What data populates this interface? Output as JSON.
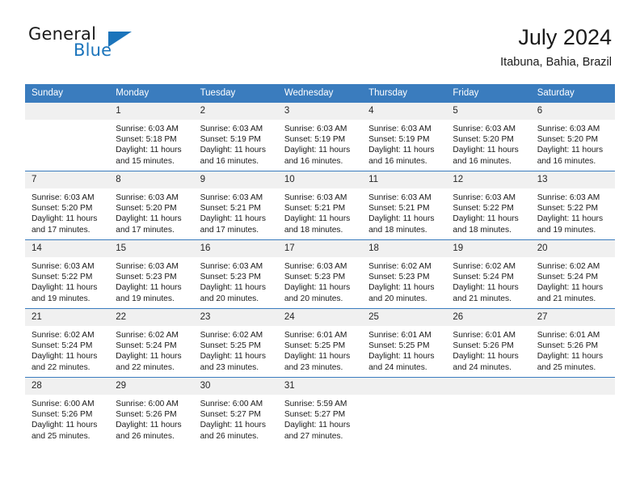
{
  "brand": {
    "name_part1": "General",
    "name_part2": "Blue",
    "logo_icon": "triangle-icon"
  },
  "header": {
    "title": "July 2024",
    "location": "Itabuna, Bahia, Brazil"
  },
  "colors": {
    "header_blue": "#3a7cbe",
    "brand_blue": "#1b74bb",
    "daynum_background": "#f0f0f0",
    "text": "#1a1a1a"
  },
  "weekdays": [
    "Sunday",
    "Monday",
    "Tuesday",
    "Wednesday",
    "Thursday",
    "Friday",
    "Saturday"
  ],
  "labels": {
    "sunrise_prefix": "Sunrise:",
    "sunset_prefix": "Sunset:",
    "daylight_prefix": "Daylight:"
  },
  "weeks": [
    [
      {
        "day": "",
        "sunrise": "",
        "sunset": "",
        "daylight_line1": "",
        "daylight_line2": ""
      },
      {
        "day": "1",
        "sunrise": "Sunrise: 6:03 AM",
        "sunset": "Sunset: 5:18 PM",
        "daylight_line1": "Daylight: 11 hours",
        "daylight_line2": "and 15 minutes."
      },
      {
        "day": "2",
        "sunrise": "Sunrise: 6:03 AM",
        "sunset": "Sunset: 5:19 PM",
        "daylight_line1": "Daylight: 11 hours",
        "daylight_line2": "and 16 minutes."
      },
      {
        "day": "3",
        "sunrise": "Sunrise: 6:03 AM",
        "sunset": "Sunset: 5:19 PM",
        "daylight_line1": "Daylight: 11 hours",
        "daylight_line2": "and 16 minutes."
      },
      {
        "day": "4",
        "sunrise": "Sunrise: 6:03 AM",
        "sunset": "Sunset: 5:19 PM",
        "daylight_line1": "Daylight: 11 hours",
        "daylight_line2": "and 16 minutes."
      },
      {
        "day": "5",
        "sunrise": "Sunrise: 6:03 AM",
        "sunset": "Sunset: 5:20 PM",
        "daylight_line1": "Daylight: 11 hours",
        "daylight_line2": "and 16 minutes."
      },
      {
        "day": "6",
        "sunrise": "Sunrise: 6:03 AM",
        "sunset": "Sunset: 5:20 PM",
        "daylight_line1": "Daylight: 11 hours",
        "daylight_line2": "and 16 minutes."
      }
    ],
    [
      {
        "day": "7",
        "sunrise": "Sunrise: 6:03 AM",
        "sunset": "Sunset: 5:20 PM",
        "daylight_line1": "Daylight: 11 hours",
        "daylight_line2": "and 17 minutes."
      },
      {
        "day": "8",
        "sunrise": "Sunrise: 6:03 AM",
        "sunset": "Sunset: 5:20 PM",
        "daylight_line1": "Daylight: 11 hours",
        "daylight_line2": "and 17 minutes."
      },
      {
        "day": "9",
        "sunrise": "Sunrise: 6:03 AM",
        "sunset": "Sunset: 5:21 PM",
        "daylight_line1": "Daylight: 11 hours",
        "daylight_line2": "and 17 minutes."
      },
      {
        "day": "10",
        "sunrise": "Sunrise: 6:03 AM",
        "sunset": "Sunset: 5:21 PM",
        "daylight_line1": "Daylight: 11 hours",
        "daylight_line2": "and 18 minutes."
      },
      {
        "day": "11",
        "sunrise": "Sunrise: 6:03 AM",
        "sunset": "Sunset: 5:21 PM",
        "daylight_line1": "Daylight: 11 hours",
        "daylight_line2": "and 18 minutes."
      },
      {
        "day": "12",
        "sunrise": "Sunrise: 6:03 AM",
        "sunset": "Sunset: 5:22 PM",
        "daylight_line1": "Daylight: 11 hours",
        "daylight_line2": "and 18 minutes."
      },
      {
        "day": "13",
        "sunrise": "Sunrise: 6:03 AM",
        "sunset": "Sunset: 5:22 PM",
        "daylight_line1": "Daylight: 11 hours",
        "daylight_line2": "and 19 minutes."
      }
    ],
    [
      {
        "day": "14",
        "sunrise": "Sunrise: 6:03 AM",
        "sunset": "Sunset: 5:22 PM",
        "daylight_line1": "Daylight: 11 hours",
        "daylight_line2": "and 19 minutes."
      },
      {
        "day": "15",
        "sunrise": "Sunrise: 6:03 AM",
        "sunset": "Sunset: 5:23 PM",
        "daylight_line1": "Daylight: 11 hours",
        "daylight_line2": "and 19 minutes."
      },
      {
        "day": "16",
        "sunrise": "Sunrise: 6:03 AM",
        "sunset": "Sunset: 5:23 PM",
        "daylight_line1": "Daylight: 11 hours",
        "daylight_line2": "and 20 minutes."
      },
      {
        "day": "17",
        "sunrise": "Sunrise: 6:03 AM",
        "sunset": "Sunset: 5:23 PM",
        "daylight_line1": "Daylight: 11 hours",
        "daylight_line2": "and 20 minutes."
      },
      {
        "day": "18",
        "sunrise": "Sunrise: 6:02 AM",
        "sunset": "Sunset: 5:23 PM",
        "daylight_line1": "Daylight: 11 hours",
        "daylight_line2": "and 20 minutes."
      },
      {
        "day": "19",
        "sunrise": "Sunrise: 6:02 AM",
        "sunset": "Sunset: 5:24 PM",
        "daylight_line1": "Daylight: 11 hours",
        "daylight_line2": "and 21 minutes."
      },
      {
        "day": "20",
        "sunrise": "Sunrise: 6:02 AM",
        "sunset": "Sunset: 5:24 PM",
        "daylight_line1": "Daylight: 11 hours",
        "daylight_line2": "and 21 minutes."
      }
    ],
    [
      {
        "day": "21",
        "sunrise": "Sunrise: 6:02 AM",
        "sunset": "Sunset: 5:24 PM",
        "daylight_line1": "Daylight: 11 hours",
        "daylight_line2": "and 22 minutes."
      },
      {
        "day": "22",
        "sunrise": "Sunrise: 6:02 AM",
        "sunset": "Sunset: 5:24 PM",
        "daylight_line1": "Daylight: 11 hours",
        "daylight_line2": "and 22 minutes."
      },
      {
        "day": "23",
        "sunrise": "Sunrise: 6:02 AM",
        "sunset": "Sunset: 5:25 PM",
        "daylight_line1": "Daylight: 11 hours",
        "daylight_line2": "and 23 minutes."
      },
      {
        "day": "24",
        "sunrise": "Sunrise: 6:01 AM",
        "sunset": "Sunset: 5:25 PM",
        "daylight_line1": "Daylight: 11 hours",
        "daylight_line2": "and 23 minutes."
      },
      {
        "day": "25",
        "sunrise": "Sunrise: 6:01 AM",
        "sunset": "Sunset: 5:25 PM",
        "daylight_line1": "Daylight: 11 hours",
        "daylight_line2": "and 24 minutes."
      },
      {
        "day": "26",
        "sunrise": "Sunrise: 6:01 AM",
        "sunset": "Sunset: 5:26 PM",
        "daylight_line1": "Daylight: 11 hours",
        "daylight_line2": "and 24 minutes."
      },
      {
        "day": "27",
        "sunrise": "Sunrise: 6:01 AM",
        "sunset": "Sunset: 5:26 PM",
        "daylight_line1": "Daylight: 11 hours",
        "daylight_line2": "and 25 minutes."
      }
    ],
    [
      {
        "day": "28",
        "sunrise": "Sunrise: 6:00 AM",
        "sunset": "Sunset: 5:26 PM",
        "daylight_line1": "Daylight: 11 hours",
        "daylight_line2": "and 25 minutes."
      },
      {
        "day": "29",
        "sunrise": "Sunrise: 6:00 AM",
        "sunset": "Sunset: 5:26 PM",
        "daylight_line1": "Daylight: 11 hours",
        "daylight_line2": "and 26 minutes."
      },
      {
        "day": "30",
        "sunrise": "Sunrise: 6:00 AM",
        "sunset": "Sunset: 5:27 PM",
        "daylight_line1": "Daylight: 11 hours",
        "daylight_line2": "and 26 minutes."
      },
      {
        "day": "31",
        "sunrise": "Sunrise: 5:59 AM",
        "sunset": "Sunset: 5:27 PM",
        "daylight_line1": "Daylight: 11 hours",
        "daylight_line2": "and 27 minutes."
      },
      {
        "day": "",
        "sunrise": "",
        "sunset": "",
        "daylight_line1": "",
        "daylight_line2": ""
      },
      {
        "day": "",
        "sunrise": "",
        "sunset": "",
        "daylight_line1": "",
        "daylight_line2": ""
      },
      {
        "day": "",
        "sunrise": "",
        "sunset": "",
        "daylight_line1": "",
        "daylight_line2": ""
      }
    ]
  ]
}
